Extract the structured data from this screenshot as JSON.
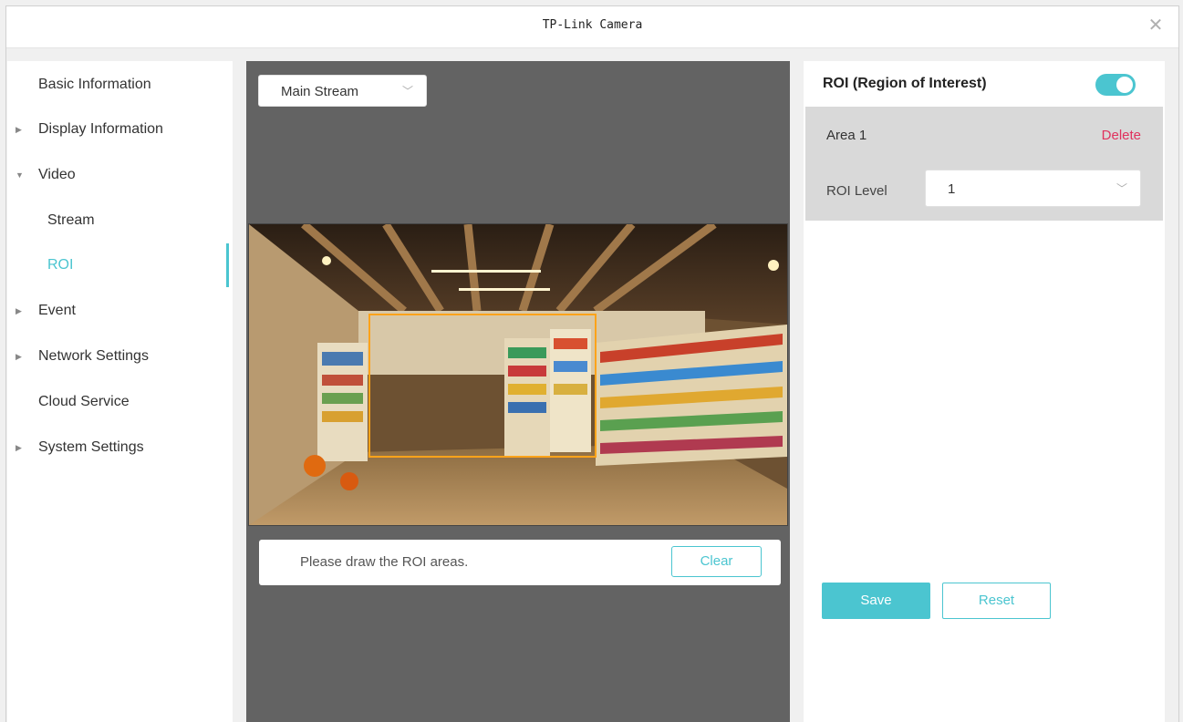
{
  "window": {
    "title": "TP-Link Camera",
    "close_icon": "close-icon"
  },
  "sidebar": {
    "items": [
      {
        "label": "Basic Information",
        "expandable": false
      },
      {
        "label": "Display Information",
        "expandable": true,
        "expanded": false
      },
      {
        "label": "Video",
        "expandable": true,
        "expanded": true
      },
      {
        "label": "Stream",
        "sub": true
      },
      {
        "label": "ROI",
        "sub": true,
        "active": true
      },
      {
        "label": "Event",
        "expandable": true,
        "expanded": false
      },
      {
        "label": "Network Settings",
        "expandable": true,
        "expanded": false
      },
      {
        "label": "Cloud Service",
        "expandable": false
      },
      {
        "label": "System Settings",
        "expandable": true,
        "expanded": false
      }
    ]
  },
  "video": {
    "stream_select": "Main Stream",
    "hint": "Please draw the ROI areas.",
    "clear_label": "Clear"
  },
  "roi": {
    "title": "ROI (Region of Interest)",
    "enabled": true,
    "area": {
      "name": "Area 1",
      "delete_label": "Delete",
      "level_label": "ROI Level",
      "level_value": "1"
    },
    "save_label": "Save",
    "reset_label": "Reset"
  },
  "colors": {
    "accent": "#4bc5d0",
    "delete": "#e0325e",
    "roi_box": "#ffa31a"
  }
}
